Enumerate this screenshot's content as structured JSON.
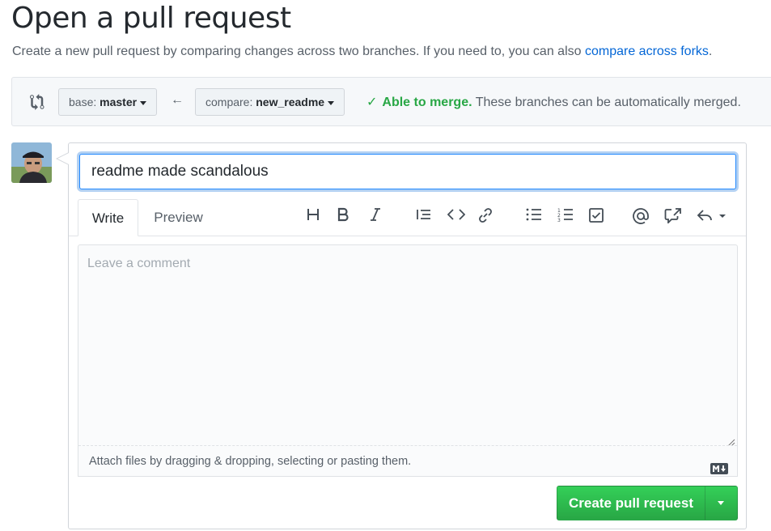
{
  "page": {
    "title": "Open a pull request",
    "subtitle_text": "Create a new pull request by comparing changes across two branches. If you need to, you can also ",
    "subtitle_link": "compare across forks",
    "subtitle_end": "."
  },
  "range": {
    "base_prefix": "base:",
    "base_branch": "master",
    "compare_prefix": "compare:",
    "compare_branch": "new_readme",
    "merge_ok": "Able to merge.",
    "merge_detail": "These branches can be automatically merged."
  },
  "form": {
    "title_value": "readme made scandalous",
    "tabs": [
      "Write",
      "Preview"
    ],
    "comment_placeholder": "Leave a comment",
    "attach_text": "Attach files by dragging & dropping, selecting or pasting them.",
    "submit_label": "Create pull request"
  },
  "toolbar": {
    "icons": [
      "header-icon",
      "bold-icon",
      "italic-icon",
      "quote-icon",
      "code-icon",
      "link-icon",
      "bulleted-list-icon",
      "numbered-list-icon",
      "task-list-icon",
      "mention-icon",
      "reference-icon",
      "reply-icon"
    ]
  },
  "colors": {
    "accent": "#0366d6",
    "success": "#28a745",
    "button_green": "#2ea44f"
  }
}
